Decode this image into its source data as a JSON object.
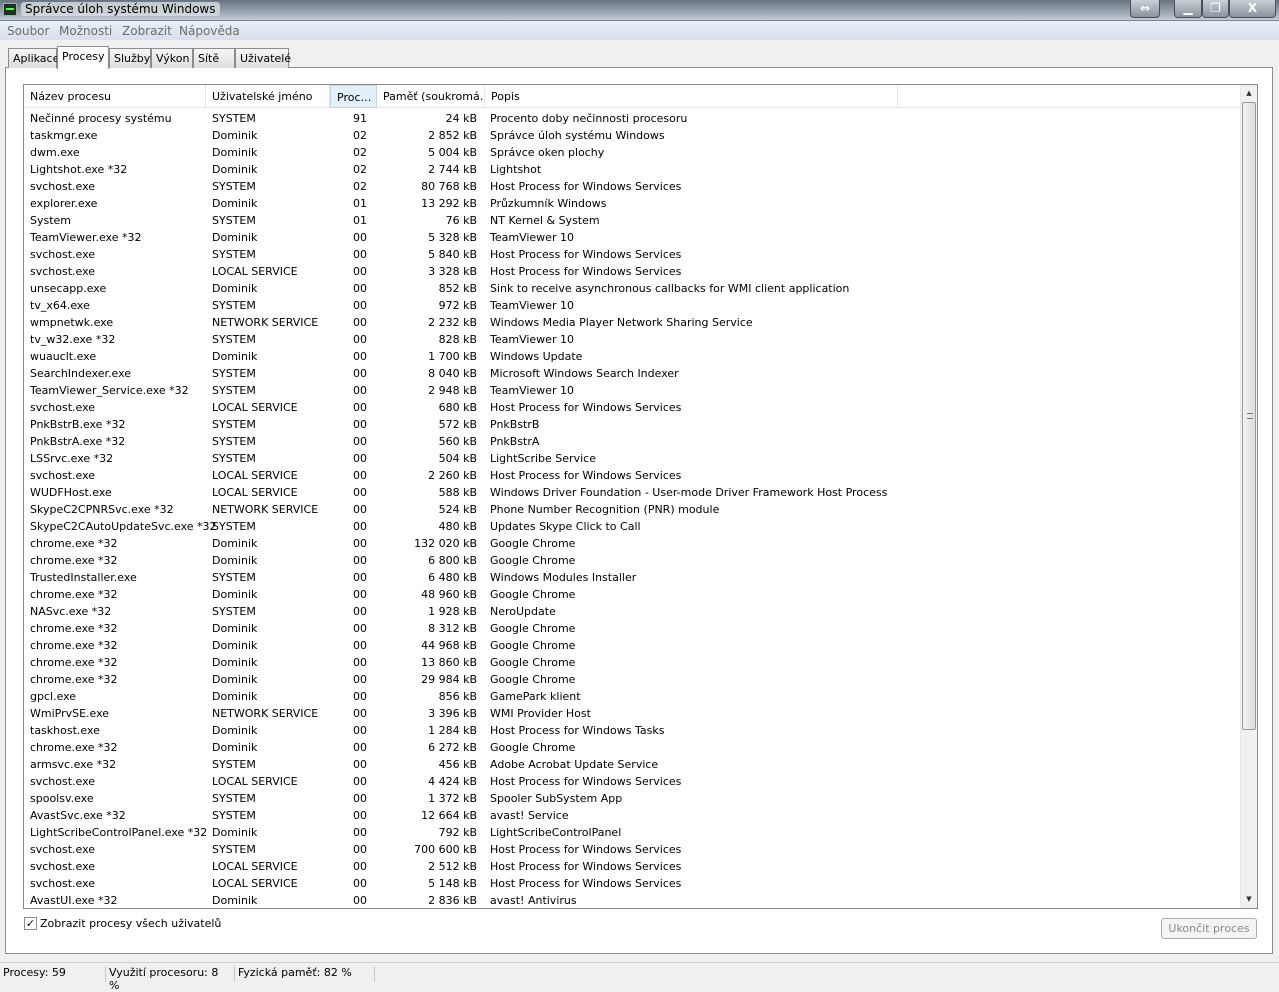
{
  "window": {
    "title": "Správce úloh systému Windows",
    "buttons": {
      "resize": "⇔",
      "minimize": "▁",
      "maximize": "❐",
      "close": "X"
    }
  },
  "menu": [
    "Soubor",
    "Možnosti",
    "Zobrazit",
    "Nápověda"
  ],
  "tabs": [
    "Aplikace",
    "Procesy",
    "Služby",
    "Výkon",
    "Sítě",
    "Uživatelé"
  ],
  "columns": [
    "Název procesu",
    "Uživatelské jméno",
    "Proc…",
    "Paměť (soukromá…",
    "Popis"
  ],
  "rows": [
    [
      "Nečinné procesy systému",
      "SYSTEM",
      "91",
      "24 kB",
      "Procento doby nečinnosti procesoru"
    ],
    [
      "taskmgr.exe",
      "Dominik",
      "02",
      "2 852 kB",
      "Správce úloh systému Windows"
    ],
    [
      "dwm.exe",
      "Dominik",
      "02",
      "5 004 kB",
      "Správce oken plochy"
    ],
    [
      "Lightshot.exe *32",
      "Dominik",
      "02",
      "2 744 kB",
      "Lightshot"
    ],
    [
      "svchost.exe",
      "SYSTEM",
      "02",
      "80 768 kB",
      "Host Process for Windows Services"
    ],
    [
      "explorer.exe",
      "Dominik",
      "01",
      "13 292 kB",
      "Průzkumník Windows"
    ],
    [
      "System",
      "SYSTEM",
      "01",
      "76 kB",
      "NT Kernel & System"
    ],
    [
      "TeamViewer.exe *32",
      "Dominik",
      "00",
      "5 328 kB",
      "TeamViewer 10"
    ],
    [
      "svchost.exe",
      "SYSTEM",
      "00",
      "5 840 kB",
      "Host Process for Windows Services"
    ],
    [
      "svchost.exe",
      "LOCAL SERVICE",
      "00",
      "3 328 kB",
      "Host Process for Windows Services"
    ],
    [
      "unsecapp.exe",
      "Dominik",
      "00",
      "852 kB",
      "Sink to receive asynchronous callbacks for WMI client application"
    ],
    [
      "tv_x64.exe",
      "SYSTEM",
      "00",
      "972 kB",
      "TeamViewer 10"
    ],
    [
      "wmpnetwk.exe",
      "NETWORK SERVICE",
      "00",
      "2 232 kB",
      "Windows Media Player Network Sharing Service"
    ],
    [
      "tv_w32.exe *32",
      "SYSTEM",
      "00",
      "828 kB",
      "TeamViewer 10"
    ],
    [
      "wuauclt.exe",
      "Dominik",
      "00",
      "1 700 kB",
      "Windows Update"
    ],
    [
      "SearchIndexer.exe",
      "SYSTEM",
      "00",
      "8 040 kB",
      "Microsoft Windows Search Indexer"
    ],
    [
      "TeamViewer_Service.exe *32",
      "SYSTEM",
      "00",
      "2 948 kB",
      "TeamViewer 10"
    ],
    [
      "svchost.exe",
      "LOCAL SERVICE",
      "00",
      "680 kB",
      "Host Process for Windows Services"
    ],
    [
      "PnkBstrB.exe *32",
      "SYSTEM",
      "00",
      "572 kB",
      "PnkBstrB"
    ],
    [
      "PnkBstrA.exe *32",
      "SYSTEM",
      "00",
      "560 kB",
      "PnkBstrA"
    ],
    [
      "LSSrvc.exe *32",
      "SYSTEM",
      "00",
      "504 kB",
      "LightScribe Service"
    ],
    [
      "svchost.exe",
      "LOCAL SERVICE",
      "00",
      "2 260 kB",
      "Host Process for Windows Services"
    ],
    [
      "WUDFHost.exe",
      "LOCAL SERVICE",
      "00",
      "588 kB",
      "Windows Driver Foundation - User-mode Driver Framework Host Process"
    ],
    [
      "SkypeC2CPNRSvc.exe *32",
      "NETWORK SERVICE",
      "00",
      "524 kB",
      "Phone Number Recognition (PNR) module"
    ],
    [
      "SkypeC2CAutoUpdateSvc.exe *32",
      "SYSTEM",
      "00",
      "480 kB",
      "Updates Skype Click to Call"
    ],
    [
      "chrome.exe *32",
      "Dominik",
      "00",
      "132 020 kB",
      "Google Chrome"
    ],
    [
      "chrome.exe *32",
      "Dominik",
      "00",
      "6 800 kB",
      "Google Chrome"
    ],
    [
      "TrustedInstaller.exe",
      "SYSTEM",
      "00",
      "6 480 kB",
      "Windows Modules Installer"
    ],
    [
      "chrome.exe *32",
      "Dominik",
      "00",
      "48 960 kB",
      "Google Chrome"
    ],
    [
      "NASvc.exe *32",
      "SYSTEM",
      "00",
      "1 928 kB",
      "NeroUpdate"
    ],
    [
      "chrome.exe *32",
      "Dominik",
      "00",
      "8 312 kB",
      "Google Chrome"
    ],
    [
      "chrome.exe *32",
      "Dominik",
      "00",
      "44 968 kB",
      "Google Chrome"
    ],
    [
      "chrome.exe *32",
      "Dominik",
      "00",
      "13 860 kB",
      "Google Chrome"
    ],
    [
      "chrome.exe *32",
      "Dominik",
      "00",
      "29 984 kB",
      "Google Chrome"
    ],
    [
      "gpcl.exe",
      "Dominik",
      "00",
      "856 kB",
      "GamePark klient"
    ],
    [
      "WmiPrvSE.exe",
      "NETWORK SERVICE",
      "00",
      "3 396 kB",
      "WMI Provider Host"
    ],
    [
      "taskhost.exe",
      "Dominik",
      "00",
      "1 284 kB",
      "Host Process for Windows Tasks"
    ],
    [
      "chrome.exe *32",
      "Dominik",
      "00",
      "6 272 kB",
      "Google Chrome"
    ],
    [
      "armsvc.exe *32",
      "SYSTEM",
      "00",
      "456 kB",
      "Adobe Acrobat Update Service"
    ],
    [
      "svchost.exe",
      "LOCAL SERVICE",
      "00",
      "4 424 kB",
      "Host Process for Windows Services"
    ],
    [
      "spoolsv.exe",
      "SYSTEM",
      "00",
      "1 372 kB",
      "Spooler SubSystem App"
    ],
    [
      "AvastSvc.exe *32",
      "SYSTEM",
      "00",
      "12 664 kB",
      "avast! Service"
    ],
    [
      "LightScribeControlPanel.exe *32",
      "Dominik",
      "00",
      "792 kB",
      "LightScribeControlPanel"
    ],
    [
      "svchost.exe",
      "SYSTEM",
      "00",
      "700 600 kB",
      "Host Process for Windows Services"
    ],
    [
      "svchost.exe",
      "LOCAL SERVICE",
      "00",
      "2 512 kB",
      "Host Process for Windows Services"
    ],
    [
      "svchost.exe",
      "LOCAL SERVICE",
      "00",
      "5 148 kB",
      "Host Process for Windows Services"
    ],
    [
      "AvastUI.exe *32",
      "Dominik",
      "00",
      "2 836 kB",
      "avast! Antivirus"
    ]
  ],
  "show_all_label": "Zobrazit procesy všech uživatelů",
  "show_all_checked": true,
  "end_process_label": "Ukončit proces",
  "status": {
    "processes": "Procesy: 59",
    "cpu": "Využití procesoru: 8 %",
    "memory": "Fyzická paměť: 82 %"
  }
}
